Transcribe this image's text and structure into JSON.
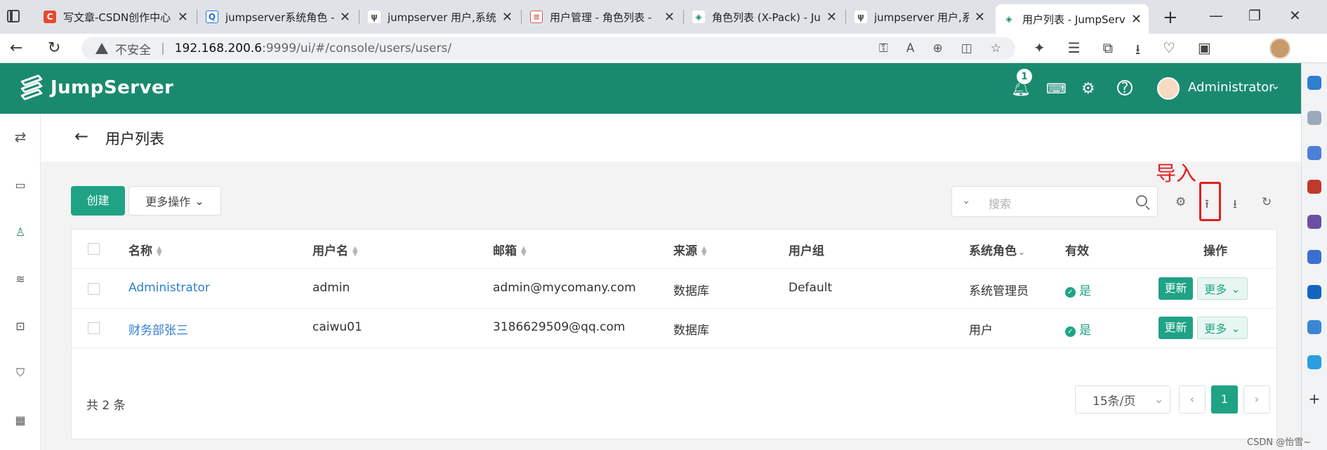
{
  "browser": {
    "tabs": [
      {
        "label": "写文章-CSDN创作中心",
        "favicon_color": "#e8492f",
        "favicon_glyph": "C"
      },
      {
        "label": "jumpserver系统角色 -",
        "favicon_color": "#2f6fd6",
        "favicon_glyph": "Q"
      },
      {
        "label": "jumpserver 用户,系统",
        "favicon_color": "#555555",
        "favicon_glyph": "ψ"
      },
      {
        "label": "用户管理 - 角色列表 -",
        "favicon_color": "#d9534f",
        "favicon_glyph": "≡"
      },
      {
        "label": "角色列表 (X-Pack) - Ju",
        "favicon_color": "#1a8a6e",
        "favicon_glyph": "◈"
      },
      {
        "label": "jumpserver 用户,系统",
        "favicon_color": "#555555",
        "favicon_glyph": "ψ"
      },
      {
        "label": "用户列表 - JumpServe",
        "favicon_color": "#1a8a6e",
        "favicon_glyph": "◈"
      }
    ],
    "address": {
      "security_label": "不安全",
      "host": "192.168.200.6",
      "path": ":9999/ui/#/console/users/users/"
    }
  },
  "app": {
    "brand": "JumpServer",
    "accent": "#1a8a6e",
    "notification_count": "1",
    "user_name": "Administrator"
  },
  "page": {
    "title": "用户列表",
    "create_label": "创建",
    "more_actions_label": "更多操作",
    "search_placeholder": "搜索",
    "annotation": "导入"
  },
  "table": {
    "headers": {
      "name": "名称",
      "username": "用户名",
      "email": "邮箱",
      "source": "来源",
      "groups": "用户组",
      "role": "系统角色",
      "active": "有效",
      "actions": "操作"
    },
    "rows": [
      {
        "name": "Administrator",
        "username": "admin",
        "email": "admin@mycomany.com",
        "source": "数据库",
        "groups": "Default",
        "role": "系统管理员",
        "active": "是",
        "update": "更新",
        "more": "更多"
      },
      {
        "name": "财务部张三",
        "username": "caiwu01",
        "email": "3186629509@qq.com",
        "source": "数据库",
        "groups": "",
        "role": "用户",
        "active": "是",
        "update": "更新",
        "more": "更多"
      }
    ]
  },
  "pagination": {
    "total": "共 2 条",
    "page_size": "15条/页",
    "current_page": "1"
  },
  "watermark": "CSDN @怡雪~"
}
